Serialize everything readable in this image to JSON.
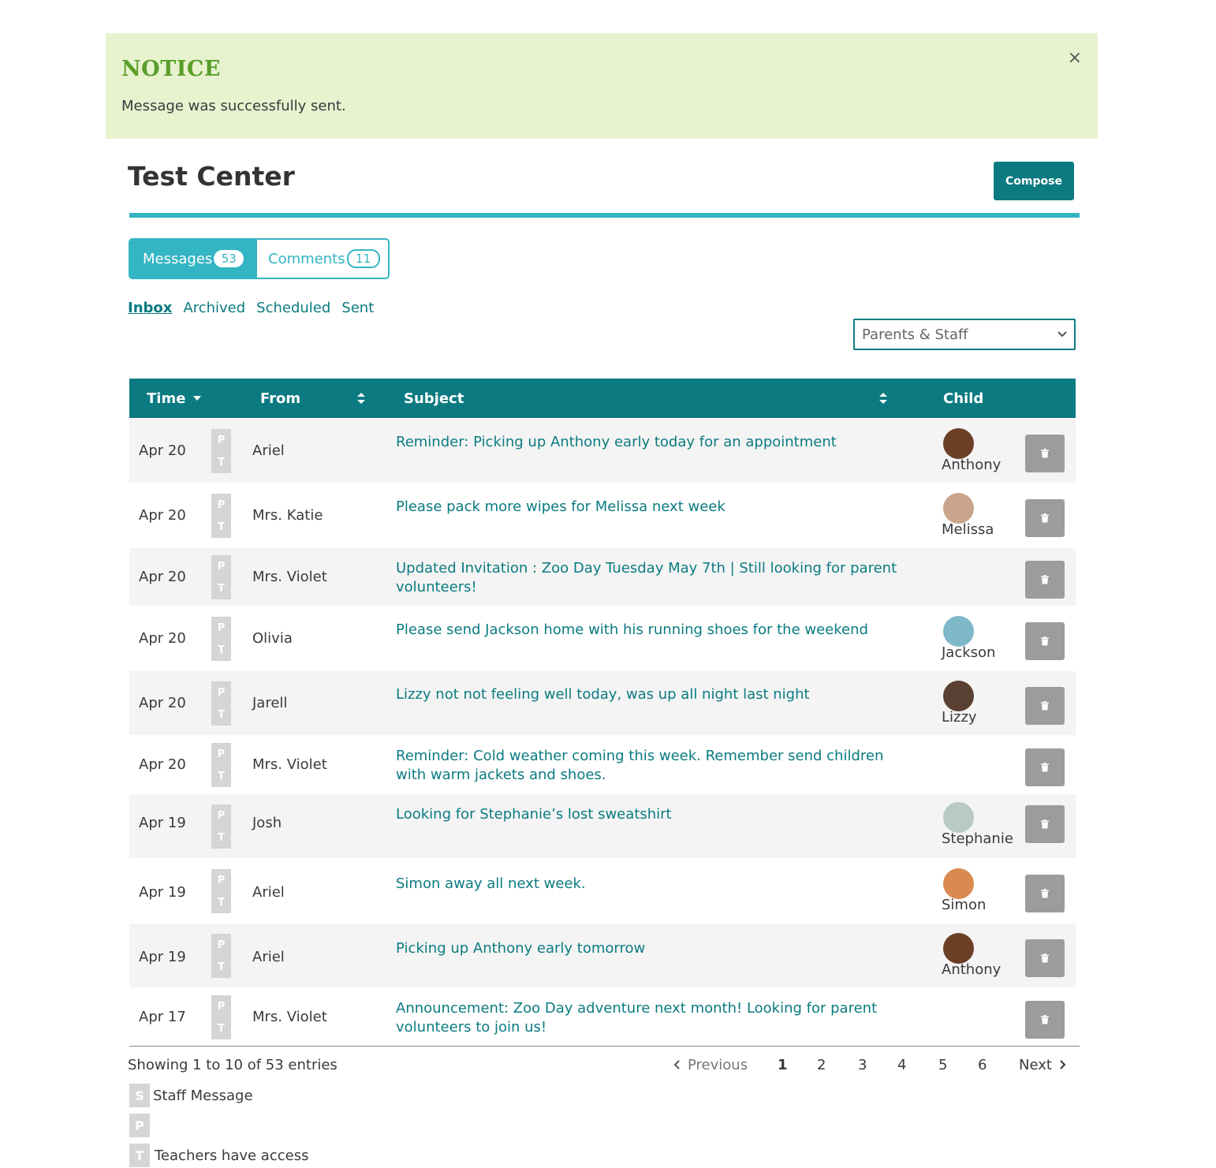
{
  "notice": {
    "title": "NOTICE",
    "message": "Message was successfully sent.",
    "close_label": "×"
  },
  "header": {
    "title": "Test Center",
    "compose_label": "Compose"
  },
  "tabs": [
    {
      "label": "Messages",
      "count": "53",
      "active": true
    },
    {
      "label": "Comments",
      "count": "11",
      "active": false
    }
  ],
  "subnav": [
    {
      "label": "Inbox",
      "active": true
    },
    {
      "label": "Archived",
      "active": false
    },
    {
      "label": "Scheduled",
      "active": false
    },
    {
      "label": "Sent",
      "active": false
    }
  ],
  "filter": {
    "selected": "Parents & Staff"
  },
  "table": {
    "columns": {
      "time": "Time",
      "from": "From",
      "subject": "Subject",
      "child": "Child"
    },
    "role_letters": [
      "P",
      "T"
    ],
    "rows": [
      {
        "date": "Apr 20",
        "from": "Ariel",
        "subject": "Reminder: Picking up Anthony early today for an appointment",
        "child": "Anthony",
        "avatar_color": "#6b3e26"
      },
      {
        "date": "Apr 20",
        "from": "Mrs. Katie",
        "subject": "Please pack more wipes for Melissa next week",
        "child": "Melissa",
        "avatar_color": "#c9a58c"
      },
      {
        "date": "Apr 20",
        "from": "Mrs. Violet",
        "subject": "Updated Invitation : Zoo Day Tuesday May 7th | Still looking for parent volunteers!",
        "child": "",
        "avatar_color": ""
      },
      {
        "date": "Apr 20",
        "from": "Olivia",
        "subject": "Please send Jackson home with his running shoes for the weekend",
        "child": "Jackson",
        "avatar_color": "#7fb8c8"
      },
      {
        "date": "Apr 20",
        "from": "Jarell",
        "subject": "Lizzy not not feeling well today, was up all night last night",
        "child": "Lizzy",
        "avatar_color": "#5a4032"
      },
      {
        "date": "Apr 20",
        "from": "Mrs. Violet",
        "subject": "Reminder: Cold weather coming this week. Remember send children with warm jackets and shoes.",
        "child": "",
        "avatar_color": ""
      },
      {
        "date": "Apr 19",
        "from": "Josh",
        "subject": "Looking for Stephanie’s lost sweatshirt",
        "child": "Stephanie",
        "avatar_color": "#b9c9c4"
      },
      {
        "date": "Apr 19",
        "from": "Ariel",
        "subject": "Simon away all next week.",
        "child": "Simon",
        "avatar_color": "#d98a4e"
      },
      {
        "date": "Apr 19",
        "from": "Ariel",
        "subject": "Picking up Anthony early tomorrow",
        "child": "Anthony",
        "avatar_color": "#6b3e26"
      },
      {
        "date": "Apr 17",
        "from": "Mrs. Violet",
        "subject": "Announcement: Zoo Day adventure next month! Looking for parent volunteers to join us!",
        "child": "",
        "avatar_color": ""
      }
    ]
  },
  "footer": {
    "info": "Showing 1 to 10 of 53 entries",
    "pagination": {
      "previous": "Previous",
      "pages": [
        "1",
        "2",
        "3",
        "4",
        "5",
        "6"
      ],
      "current": "1",
      "next": "Next"
    }
  },
  "legend": [
    {
      "letter": "S",
      "label": "Staff Message"
    },
    {
      "letter": "P",
      "label": ""
    },
    {
      "letter": "T",
      "label": "Teachers have access"
    }
  ],
  "colors": {
    "accent": "#0b7b81",
    "tab_accent": "#34b5c4",
    "notice_bg": "#e7f2cf",
    "notice_title": "#5a9e2a"
  },
  "icons": {
    "close": "close-icon",
    "sort_desc": "sort-desc-icon",
    "sort": "sort-icon",
    "dropdown": "chevron-down-icon",
    "delete": "trash-icon",
    "prev": "chevron-left-icon",
    "next": "chevron-right-icon"
  }
}
